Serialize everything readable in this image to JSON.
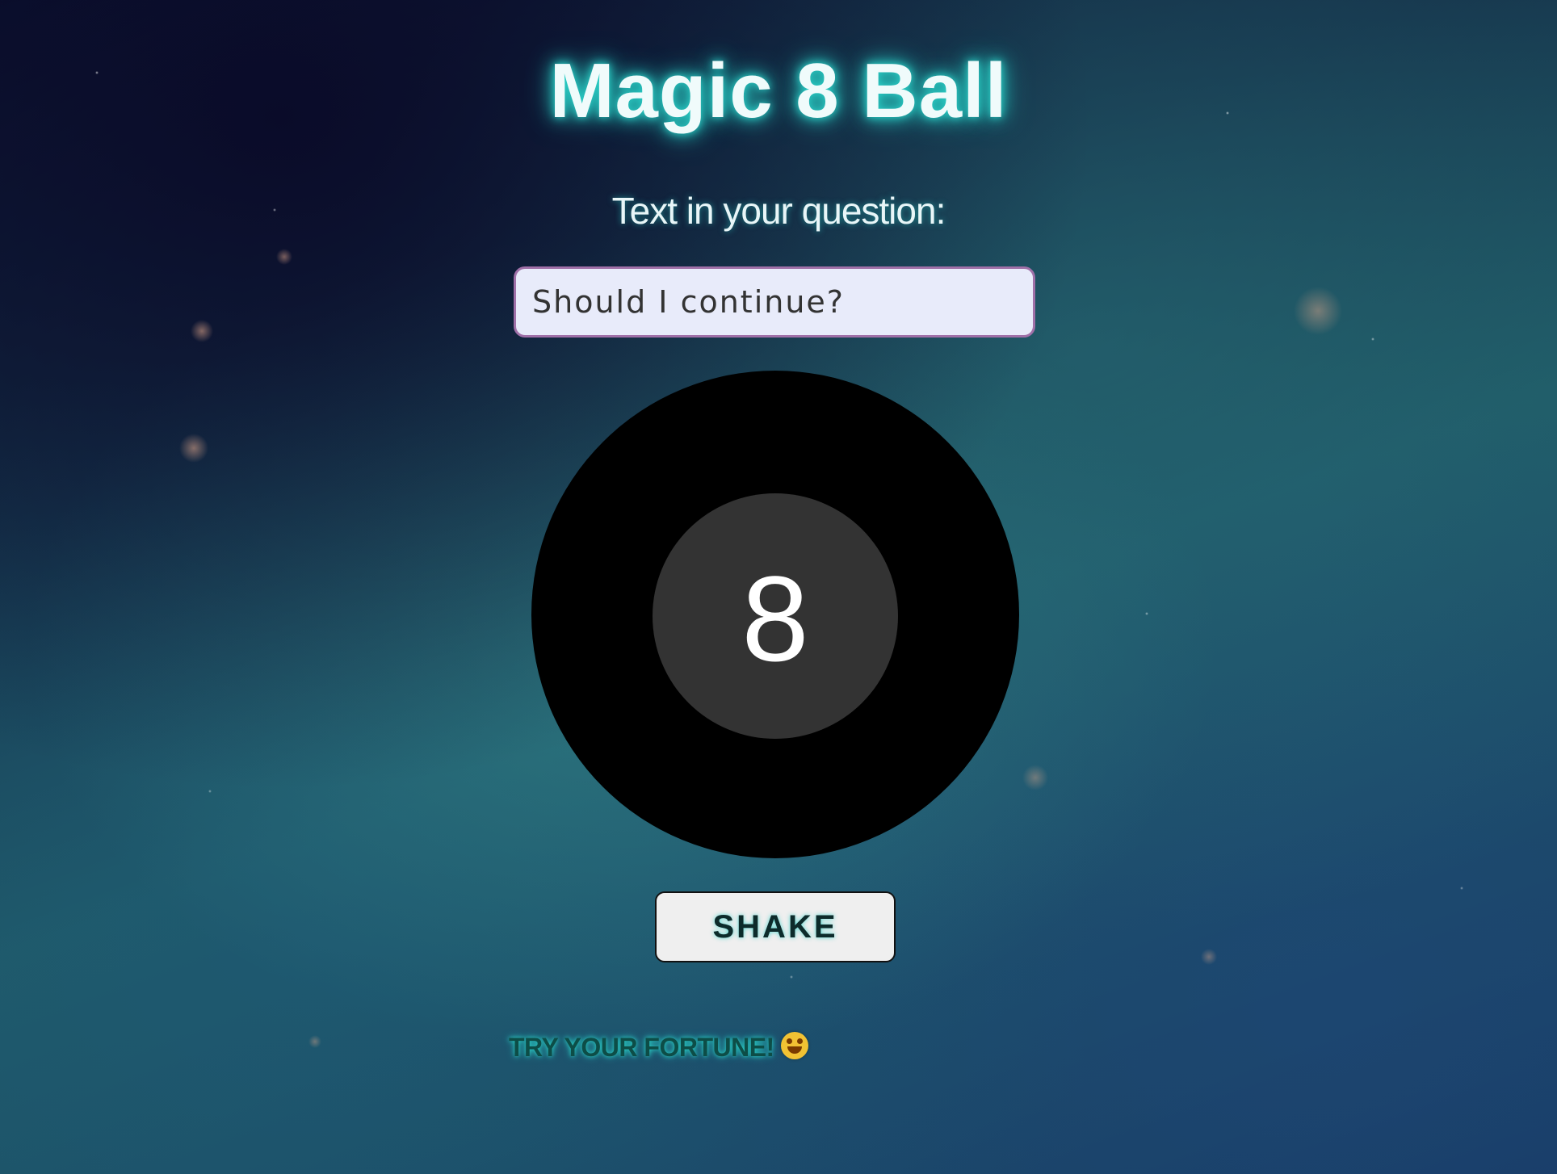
{
  "app": {
    "title": "Magic 8 Ball"
  },
  "question": {
    "prompt": "Text in your question:",
    "value": "Should I continue?"
  },
  "ball": {
    "number": "8"
  },
  "controls": {
    "shake_label": "SHAKE"
  },
  "footer": {
    "text": "TRY YOUR FORTUNE!",
    "icon": "star-struck-emoji-icon"
  },
  "colors": {
    "glow": "#2ad1c8",
    "ball": "#000000",
    "ball_window": "#333333",
    "input_bg": "#e8ebfa",
    "input_border": "#a070a8"
  }
}
